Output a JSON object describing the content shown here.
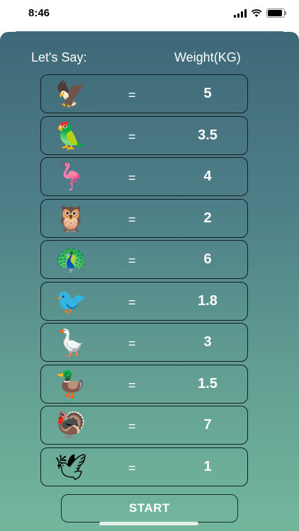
{
  "status_bar": {
    "time": "8:46"
  },
  "header": {
    "left_label": "Let's Say:",
    "right_label": "Weight(KG)"
  },
  "rows": [
    {
      "icon": "eagle-icon",
      "glyph": "🦅",
      "eq": "=",
      "value": "5"
    },
    {
      "icon": "parrot-icon",
      "glyph": "🦜",
      "eq": "=",
      "value": "3.5"
    },
    {
      "icon": "flamingo-icon",
      "glyph": "🦩",
      "eq": "=",
      "value": "4"
    },
    {
      "icon": "owl-icon",
      "glyph": "🦉",
      "eq": "=",
      "value": "2"
    },
    {
      "icon": "peacock-icon",
      "glyph": "🦚",
      "eq": "=",
      "value": "6"
    },
    {
      "icon": "bluebird-icon",
      "glyph": "🐦",
      "eq": "=",
      "value": "1.8"
    },
    {
      "icon": "goose-icon",
      "glyph": "🪿",
      "eq": "=",
      "value": "3"
    },
    {
      "icon": "duck-icon",
      "glyph": "🦆",
      "eq": "=",
      "value": "1.5"
    },
    {
      "icon": "turkey-icon",
      "glyph": "🦃",
      "eq": "=",
      "value": "7"
    },
    {
      "icon": "pigeon-icon",
      "glyph": "🕊",
      "eq": "=",
      "value": "1"
    }
  ],
  "start_button": {
    "label": "START"
  },
  "colors": {
    "bg_top": "#3f6878",
    "bg_bottom": "#72b79c",
    "border": "#141d22",
    "text": "#ffffff"
  }
}
